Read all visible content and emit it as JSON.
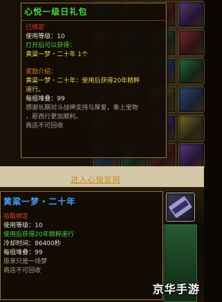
{
  "tooltip1": {
    "title": "心悦一级日礼包",
    "bound": "已绑定",
    "use_level": "使用等级：10",
    "obtain_label": "打开后可以获得：",
    "obtain_item": "黄粱一梦・二十年 1个",
    "reward_label": "奖励介绍：",
    "reward_line1": "黄粱一梦・二十年：使用后获得20年精粹",
    "reward_line2": "道行。",
    "stack": "每组堆叠：99",
    "thanks_line1": "感谢长期对斗战神支持与厚爱，奉上宝物",
    "thanks_line2": "，愿西行更加顺利。",
    "shop": "商店不可回收"
  },
  "official_link": "进入心悦官网",
  "tooltip2": {
    "title": "黄粱一梦・二十年",
    "bind_type": "拾取绑定",
    "use_level": "使用等级：10",
    "effect": "使用后获得20年精粹道行",
    "cooldown": "冷却时间：86400秒",
    "stack": "每组堆叠：99",
    "desc": "原来只是一场梦",
    "shop": "商店不可回收"
  },
  "watermark": "京华手游",
  "colors": {
    "title_green": "#45d84a",
    "title_blue": "#4aa0ff",
    "bound_red": "#e04030",
    "effect_green": "#48d050",
    "item_yellow": "#f0d060",
    "link_gold": "#c88a18"
  }
}
